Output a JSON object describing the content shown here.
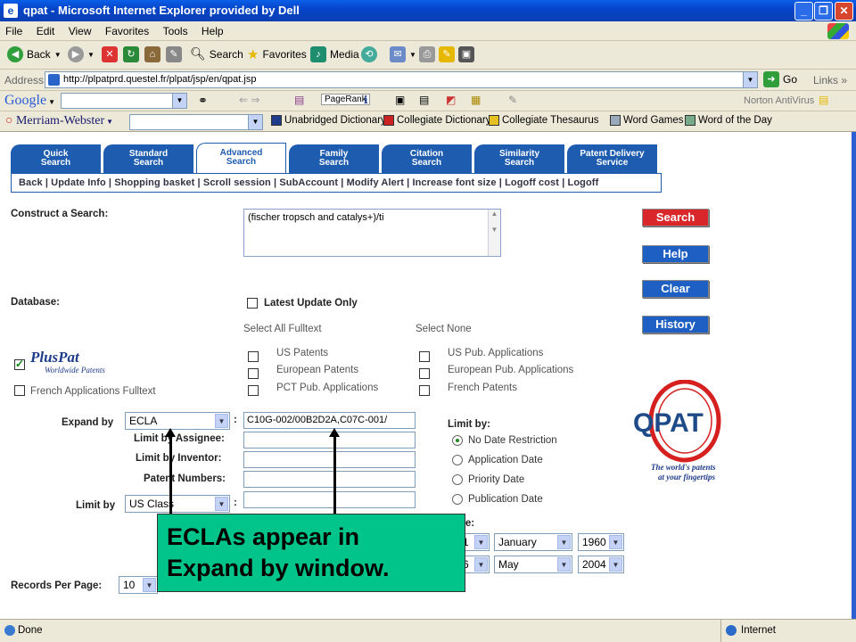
{
  "window": {
    "title": "qpat - Microsoft Internet Explorer provided by Dell"
  },
  "menu": [
    "File",
    "Edit",
    "View",
    "Favorites",
    "Tools",
    "Help"
  ],
  "toolbar": {
    "back": "Back",
    "search": "Search",
    "favorites": "Favorites",
    "media": "Media"
  },
  "address": {
    "label": "Address",
    "url": "http://plpatprd.questel.fr/plpat/jsp/en/qpat.jsp",
    "go": "Go",
    "links": "Links"
  },
  "google": {
    "logo": "Google",
    "pagerank": "PageRank",
    "norton": "Norton AntiVirus"
  },
  "mw": {
    "logo": "Merriam-Webster",
    "unabridged": "Unabridged Dictionary",
    "collegiate_dict": "Collegiate Dictionary",
    "collegiate_thes": "Collegiate Thesaurus",
    "word_games": "Word Games",
    "word_of_day": "Word of the Day"
  },
  "tabs": [
    {
      "line1": "Quick",
      "line2": "Search"
    },
    {
      "line1": "Standard",
      "line2": "Search"
    },
    {
      "line1": "Advanced",
      "line2": "Search"
    },
    {
      "line1": "Family",
      "line2": "Search"
    },
    {
      "line1": "Citation",
      "line2": "Search"
    },
    {
      "line1": "Similarity",
      "line2": "Search"
    },
    {
      "line1": "Patent Delivery",
      "line2": "Service"
    }
  ],
  "subnav": "Back | Update Info | Shopping basket | Scroll session | SubAccount | Modify Alert | Increase font size | Logoff cost | Logoff",
  "form": {
    "construct_label": "Construct a Search:",
    "query": "(fischer tropsch and catalys+)/ti",
    "database_label": "Database:",
    "latest_update": "Latest Update Only",
    "select_all": "Select All Fulltext",
    "select_none": "Select None",
    "pluspat": "PlusPat",
    "pluspat_sub": "Worldwide Patents",
    "french_fulltext": "French Applications Fulltext",
    "db_col1": [
      "US Patents",
      "European Patents",
      "PCT Pub. Applications"
    ],
    "db_col2": [
      "US Pub. Applications",
      "European Pub. Applications",
      "French Patents"
    ],
    "expand_by_label": "Expand by",
    "expand_by_value": "ECLA",
    "expand_text": "C10G-002/00B2D2A,C07C-001/",
    "limit_assignee": "Limit by Assignee:",
    "limit_inventor": "Limit by Inventor:",
    "patent_numbers": "Patent Numbers:",
    "limit_by_label": "Limit by",
    "limit_by_value": "US Class",
    "limit_by_right": "Limit by:",
    "date_options": [
      "No Date Restriction",
      "Application Date",
      "Priority Date",
      "Publication Date"
    ],
    "date_range_label": "te:",
    "from": {
      "day": "1",
      "month": "January",
      "year": "1960"
    },
    "to": {
      "day": "6",
      "month": "May",
      "year": "2004"
    },
    "records_label": "Records Per Page:",
    "records_value": "10"
  },
  "buttons": {
    "search": "Search",
    "help": "Help",
    "clear": "Clear",
    "history": "History"
  },
  "qpat": {
    "logo": "QPAT",
    "tagline1": "The world's patents",
    "tagline2": "at your fingertips"
  },
  "callout": {
    "line1": "ECLAs appear in",
    "line2": "Expand by window."
  },
  "status": {
    "done": "Done",
    "zone": "Internet"
  }
}
